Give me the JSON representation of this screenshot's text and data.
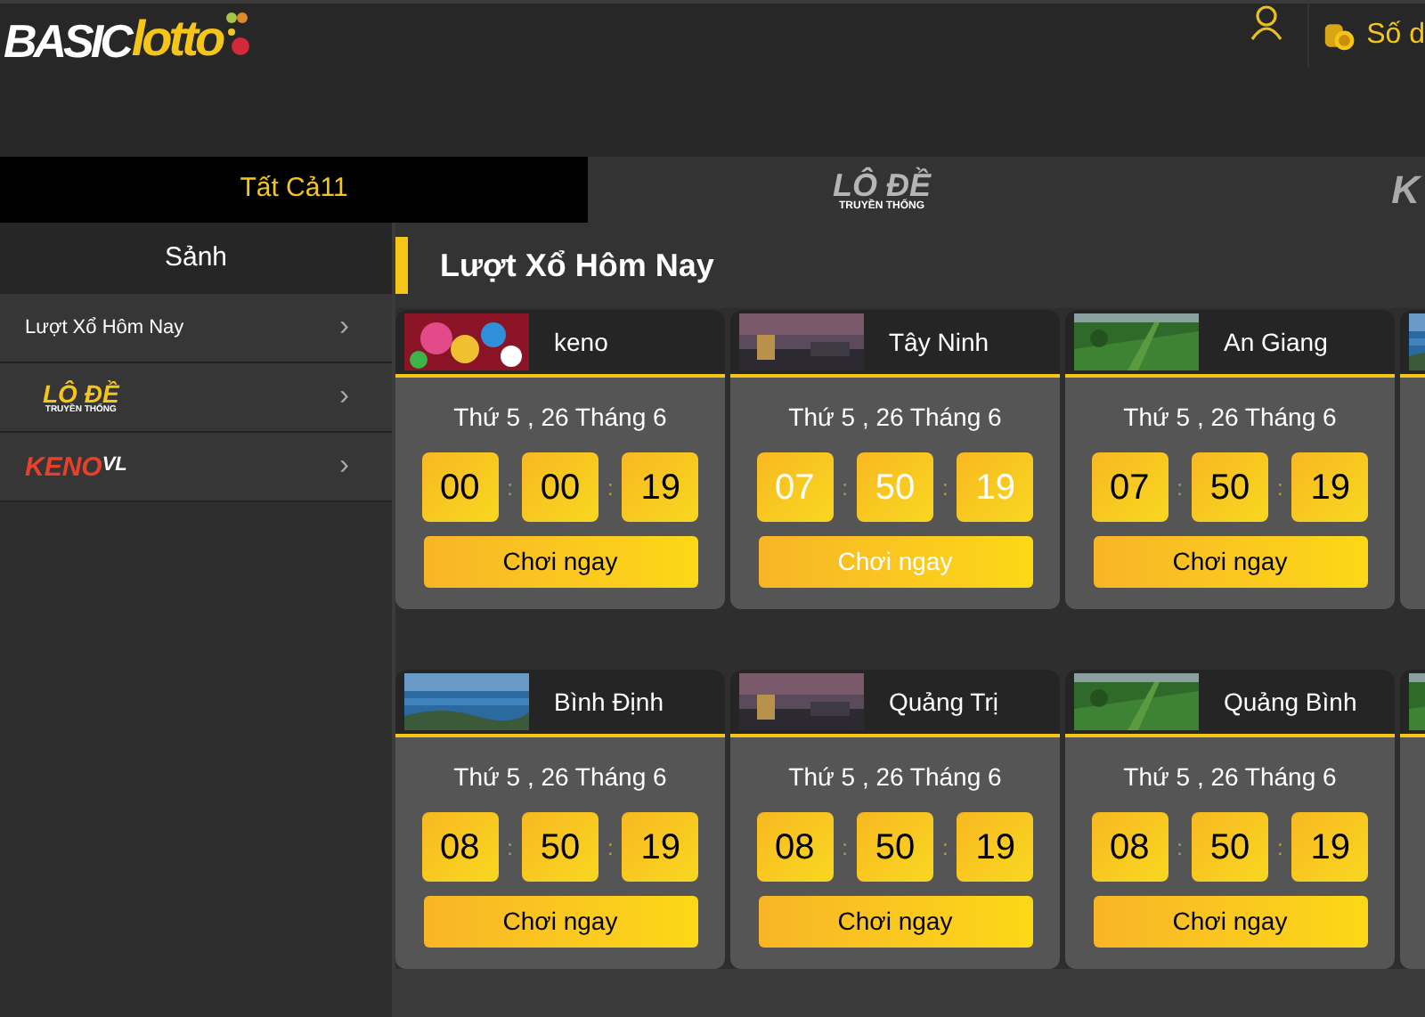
{
  "logo": {
    "part_1": "BASIC",
    "part_2": "lotto"
  },
  "header": {
    "balance_label": "Số d"
  },
  "tabs": [
    {
      "kind": "text",
      "label": "Tất Cả11",
      "selected": true
    },
    {
      "kind": "lode",
      "label": "LÔ ĐỀ",
      "sublabel": "TRUYỀN THỐNG",
      "selected": false
    },
    {
      "kind": "keno",
      "label": "K",
      "selected": false
    }
  ],
  "sidebar": {
    "title": "Sảnh",
    "items": [
      {
        "kind": "text",
        "label": "Lượt Xổ Hôm Nay",
        "chevron": "›"
      },
      {
        "kind": "lode",
        "label": "LÔ ĐỀ",
        "sublabel": "TRUYỀN THỐNG",
        "chevron": "›"
      },
      {
        "kind": "keno",
        "label": "KENO",
        "suffix": "VL",
        "chevron": "›"
      }
    ]
  },
  "section_title": "Lượt Xổ Hôm Nay",
  "cards": [
    {
      "kind": "full",
      "name": "keno",
      "date": "Thứ 5 , 26 Tháng 6",
      "time": [
        "00",
        "00",
        "19"
      ],
      "separators": [
        ":",
        ":"
      ],
      "button": "Chơi ngay",
      "highlighted": false
    },
    {
      "kind": "full",
      "name": "Tây Ninh",
      "date": "Thứ 5 , 26 Tháng 6",
      "time": [
        "07",
        "50",
        "19"
      ],
      "separators": [
        ":",
        ":"
      ],
      "button": "Chơi ngay",
      "highlighted": true
    },
    {
      "kind": "full",
      "name": "An Giang",
      "date": "Thứ 5 , 26 Tháng 6",
      "time": [
        "07",
        "50",
        "19"
      ],
      "separators": [
        ":",
        ":"
      ],
      "button": "Chơi ngay",
      "highlighted": false
    },
    {
      "kind": "cut"
    },
    {
      "kind": "full",
      "name": "Bình Định",
      "date": "Thứ 5 , 26 Tháng 6",
      "time": [
        "08",
        "50",
        "19"
      ],
      "separators": [
        ":",
        ":"
      ],
      "button": "Chơi ngay",
      "highlighted": false
    },
    {
      "kind": "full",
      "name": "Quảng Trị",
      "date": "Thứ 5 , 26 Tháng 6",
      "time": [
        "08",
        "50",
        "19"
      ],
      "separators": [
        ":",
        ":"
      ],
      "button": "Chơi ngay",
      "highlighted": false
    },
    {
      "kind": "full",
      "name": "Quảng Bình",
      "date": "Thứ 5 , 26 Tháng 6",
      "time": [
        "08",
        "50",
        "19"
      ],
      "separators": [
        ":",
        ":"
      ],
      "button": "Chơi ngay",
      "highlighted": false
    },
    {
      "kind": "cut"
    }
  ]
}
